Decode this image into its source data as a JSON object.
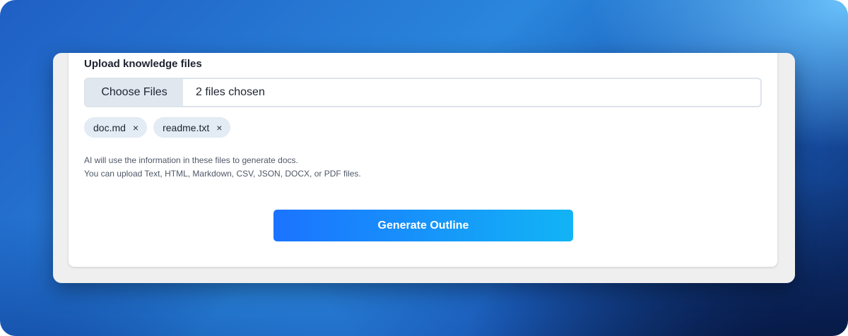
{
  "upload": {
    "label": "Upload knowledge files",
    "choose_button": "Choose Files",
    "status": "2 files chosen",
    "files": [
      {
        "name": "doc.md",
        "remove_icon": "×"
      },
      {
        "name": "readme.txt",
        "remove_icon": "×"
      }
    ],
    "help_line1": "AI will use the information in these files to generate docs.",
    "help_line2": "You can upload Text, HTML, Markdown, CSV, JSON, DOCX, or PDF files."
  },
  "actions": {
    "generate_label": "Generate Outline"
  },
  "colors": {
    "accent_start": "#1b73ff",
    "accent_end": "#12b4f5",
    "chip_bg": "#e3ebf4"
  }
}
